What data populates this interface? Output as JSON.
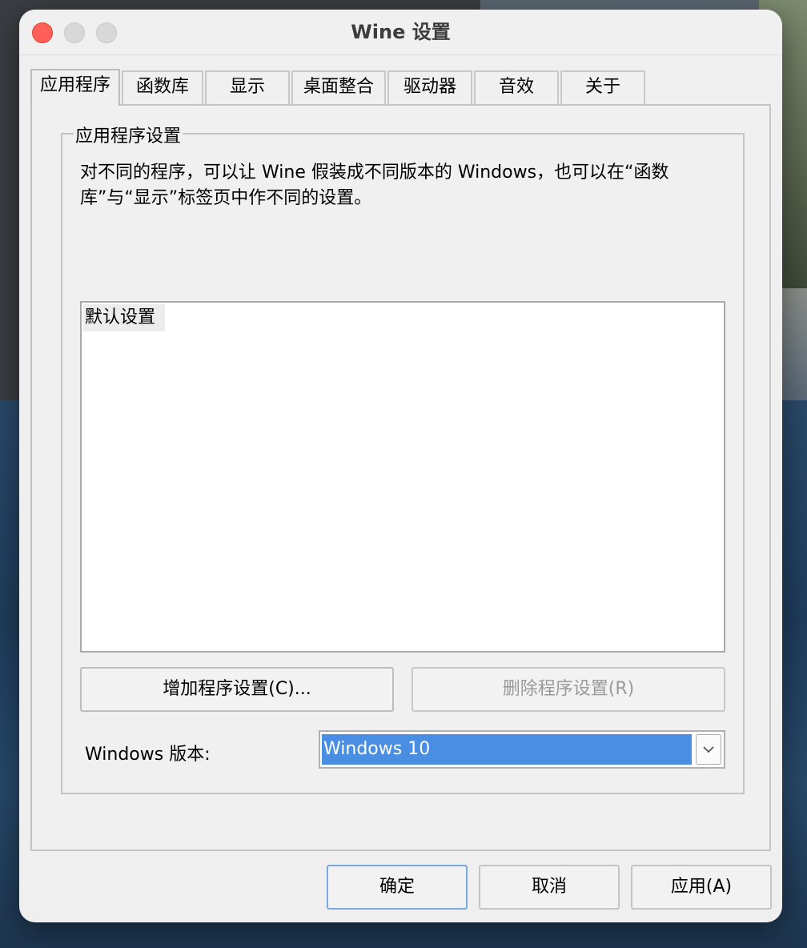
{
  "window": {
    "title": "Wine 设置"
  },
  "tabs": [
    {
      "label": "应用程序",
      "active": true
    },
    {
      "label": "函数库"
    },
    {
      "label": "显示"
    },
    {
      "label": "桌面整合"
    },
    {
      "label": "驱动器"
    },
    {
      "label": "音效"
    },
    {
      "label": "关于"
    }
  ],
  "group": {
    "label": "应用程序设置",
    "description": "对不同的程序，可以让 Wine 假装成不同版本的 Windows，也可以在“函数库”与“显示”标签页中作不同的设置。",
    "list_items": [
      "默认设置"
    ]
  },
  "buttons": {
    "add_label": "增加程序设置(C)...",
    "remove_label": "删除程序设置(R)"
  },
  "version": {
    "label": "Windows 版本:",
    "selected": "Windows 10"
  },
  "footer": {
    "ok_label": "确定",
    "cancel_label": "取消",
    "apply_label": "应用(A)"
  },
  "colors": {
    "selection": "#4a8ee4",
    "close_button": "#fe5f57"
  }
}
